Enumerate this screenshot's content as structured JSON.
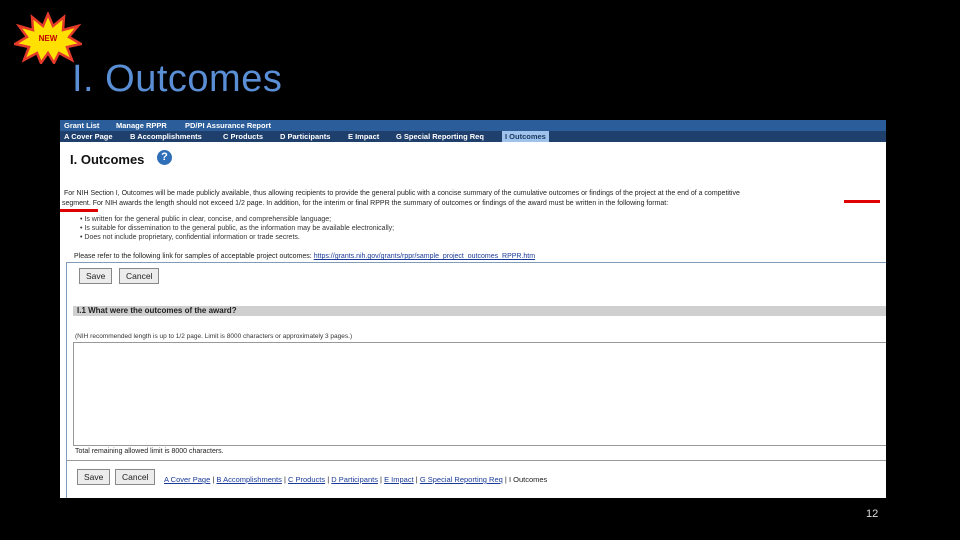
{
  "badge": {
    "label": "NEW",
    "fill": "#ffe000",
    "stroke": "#e33a2a"
  },
  "slide": {
    "title": "I. Outcomes",
    "page_number": "12",
    "title_color": "#5a8fd6"
  },
  "nav_top": [
    "Grant List",
    "Manage RPPR",
    "PD/PI Assurance Report"
  ],
  "nav_sections": [
    "A Cover Page",
    "B Accomplishments",
    "C Products",
    "D Participants",
    "E Impact",
    "G Special Reporting Req",
    "I Outcomes"
  ],
  "page": {
    "heading": "I. Outcomes",
    "intro_line1": "For NIH Section I, Outcomes will be made publicly available, thus allowing recipients to provide the general public with a concise summary of the cumulative outcomes or findings of the project at the end of a competitive",
    "intro_line2": "segment. For NIH awards the length should not exceed 1/2 page. In addition, for the interim or final RPPR the summary of outcomes or findings of the award must be written in the following format:",
    "bullets": [
      "Is written for the general public in clear, concise, and comprehensible language;",
      "Is suitable for dissemination to the general public, as the information may be available electronically;",
      "Does not include proprietary, confidential information or trade secrets."
    ],
    "link_prefix": "Please refer to the following link for samples of acceptable project outcomes:",
    "link_url": "https://grants.nih.gov/grants/rppr/sample_project_outcomes_RPPR.htm"
  },
  "buttons": {
    "save": "Save",
    "cancel": "Cancel"
  },
  "question": {
    "title": "I.1 What were the outcomes of the award?",
    "note": "(NIH recommended length is up to 1/2 page. Limit is 8000 characters or approximately 3 pages.)",
    "value": "",
    "remaining": "Total remaining allowed limit is 8000 characters."
  },
  "bottom_nav": {
    "links": [
      "A Cover Page",
      "B Accomplishments",
      "C Products",
      "D Participants",
      "E Impact",
      "G Special Reporting Req"
    ],
    "current": "I Outcomes",
    "separator": "|"
  }
}
